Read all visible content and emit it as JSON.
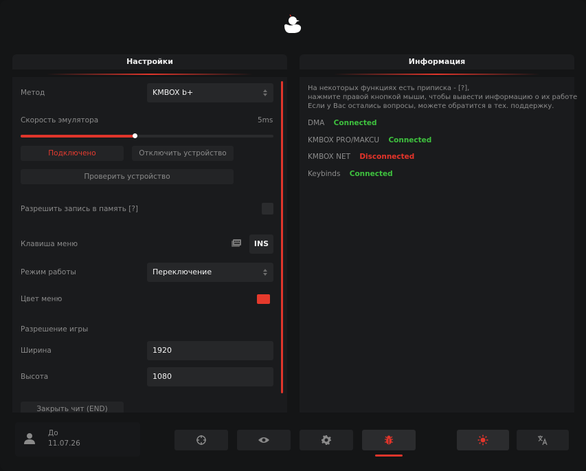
{
  "colors": {
    "accent": "#e0352b",
    "connected": "#3ec13e",
    "disconnected": "#e5342a",
    "menu_color_swatch": "#e63a2c"
  },
  "logo": {
    "icon": "duck-logo-icon"
  },
  "settings": {
    "title": "Настройки",
    "method_label": "Метод",
    "method_value": "KMBOX b+",
    "emulator_speed_label": "Скорость эмулятора",
    "emulator_speed_value": "5ms",
    "emulator_speed_fraction": 0.45,
    "connected_button": "Подключено",
    "disconnect_button": "Отключить устройство",
    "check_button": "Проверить устройство",
    "allow_memory_write_label": "Разрешить запись в память [?]",
    "allow_memory_write_checked": false,
    "menu_key_label": "Клавиша меню",
    "menu_key_value": "INS",
    "mode_label": "Режим работы",
    "mode_value": "Переключение",
    "menu_color_label": "Цвет меню",
    "resolution_title": "Разрешение игры",
    "width_label": "Ширина",
    "width_value": "1920",
    "height_label": "Высота",
    "height_value": "1080",
    "close_button": "Закрыть чит (END)"
  },
  "info": {
    "title": "Информация",
    "lines": [
      "На некоторых функциях есть приписка - [?],",
      "нажмите правой кнопкой мыши, чтобы вывести информацию о их работе.",
      "Если у Вас остались вопросы, можете обратится в тех. поддержку."
    ],
    "statuses": [
      {
        "name": "DMA",
        "status": "Connected",
        "ok": true
      },
      {
        "name": "KMBOX PRO/MAKCU",
        "status": "Connected",
        "ok": true
      },
      {
        "name": "KMBOX NET",
        "status": "Disconnected",
        "ok": false
      },
      {
        "name": "Keybinds",
        "status": "Connected",
        "ok": true
      }
    ]
  },
  "footer": {
    "user_line1": "До",
    "user_line2": "11.07.26",
    "tabs": [
      "crosshair-icon",
      "eye-icon",
      "gear-icon",
      "bug-icon"
    ],
    "active_tab": "bug-icon",
    "theme_icon": "sun-icon",
    "language_icon": "translate-icon"
  }
}
